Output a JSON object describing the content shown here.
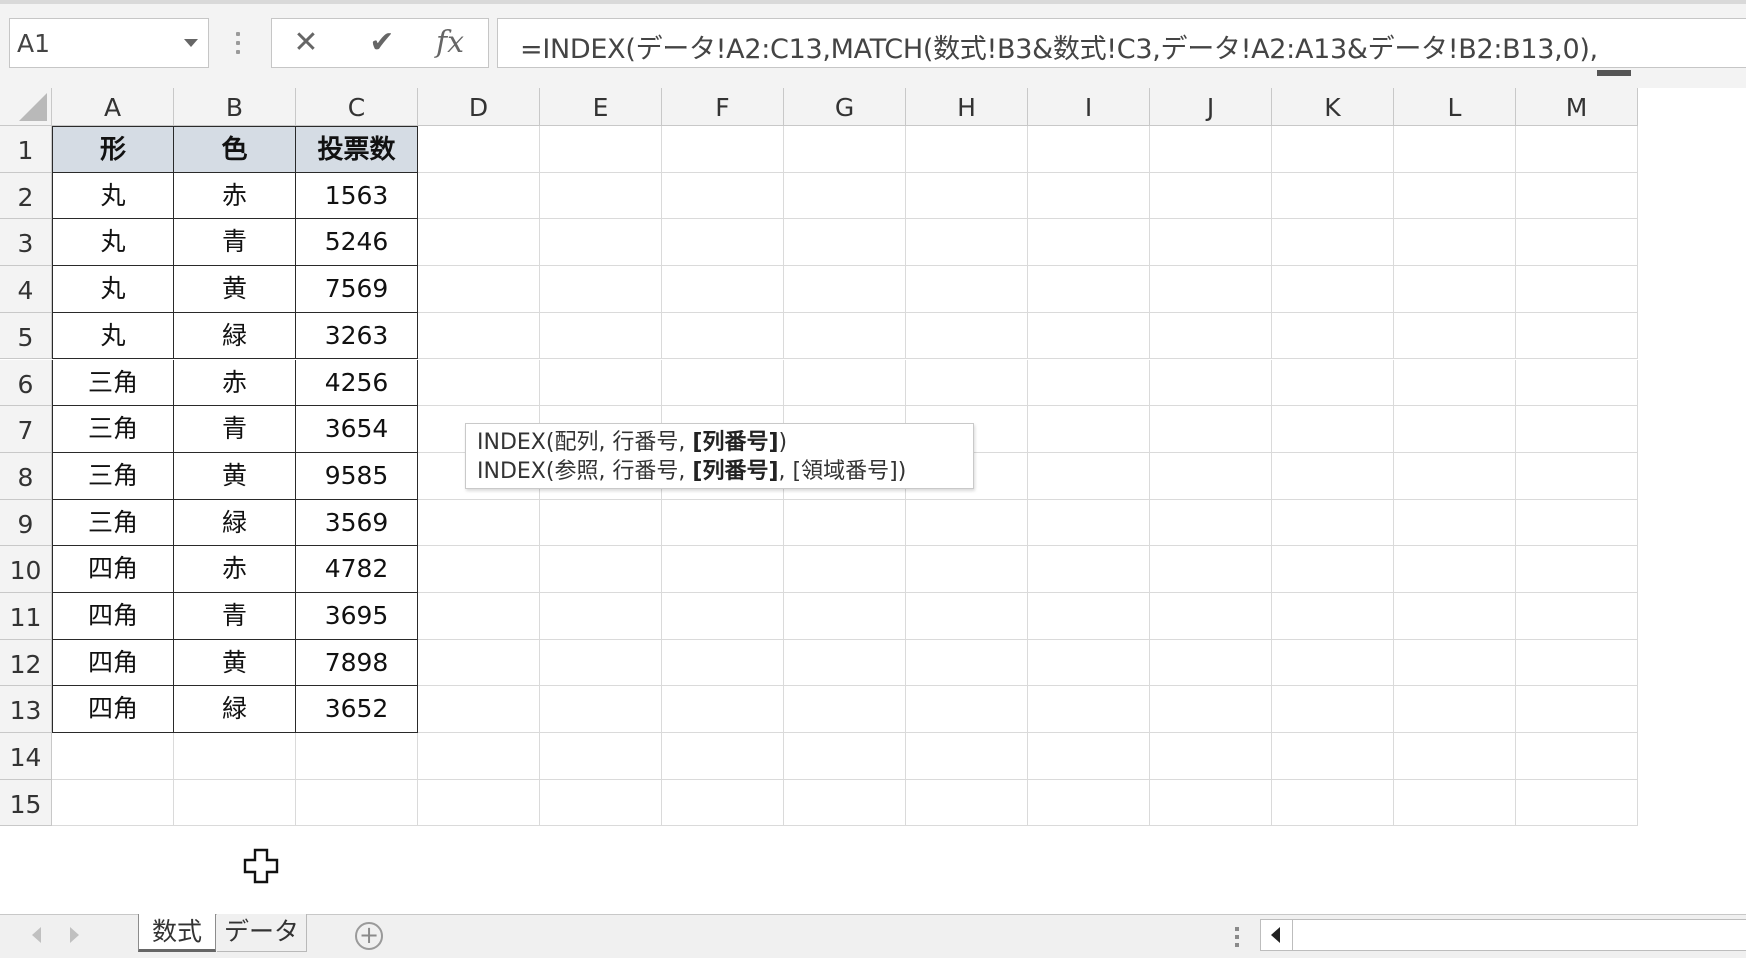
{
  "namebox": {
    "value": "A1"
  },
  "formula_bar": {
    "cancel_glyph": "✕",
    "enter_glyph": "✔",
    "fx_label": "fx",
    "formula": "=INDEX(データ!A2:C13,MATCH(数式!B3&数式!C3,データ!A2:A13&データ!B2:B13,0),"
  },
  "columns": [
    "A",
    "B",
    "C",
    "D",
    "E",
    "F",
    "G",
    "H",
    "I",
    "J",
    "K",
    "L",
    "M"
  ],
  "rows": [
    "1",
    "2",
    "3",
    "4",
    "5",
    "6",
    "7",
    "8",
    "9",
    "10",
    "11",
    "12",
    "13",
    "14",
    "15"
  ],
  "table": {
    "headers": [
      "形",
      "色",
      "投票数"
    ],
    "rows": [
      [
        "丸",
        "赤",
        "1563"
      ],
      [
        "丸",
        "青",
        "5246"
      ],
      [
        "丸",
        "黄",
        "7569"
      ],
      [
        "丸",
        "緑",
        "3263"
      ],
      [
        "三角",
        "赤",
        "4256"
      ],
      [
        "三角",
        "青",
        "3654"
      ],
      [
        "三角",
        "黄",
        "9585"
      ],
      [
        "三角",
        "緑",
        "3569"
      ],
      [
        "四角",
        "赤",
        "4782"
      ],
      [
        "四角",
        "青",
        "3695"
      ],
      [
        "四角",
        "黄",
        "7898"
      ],
      [
        "四角",
        "緑",
        "3652"
      ]
    ]
  },
  "tooltip": {
    "line1_prefix": "INDEX(配列, 行番号, ",
    "line1_bold": "[列番号]",
    "line1_suffix": ")",
    "line2_prefix": "INDEX(参照, 行番号, ",
    "line2_bold": "[列番号]",
    "line2_suffix": ", [領域番号])"
  },
  "sheets": {
    "tab1": "数式",
    "tab2": "データ",
    "add": "+"
  },
  "colors": {
    "header_fill": "#d5dce4",
    "grid_line": "#dadada",
    "table_border": "#2a2a2a"
  }
}
